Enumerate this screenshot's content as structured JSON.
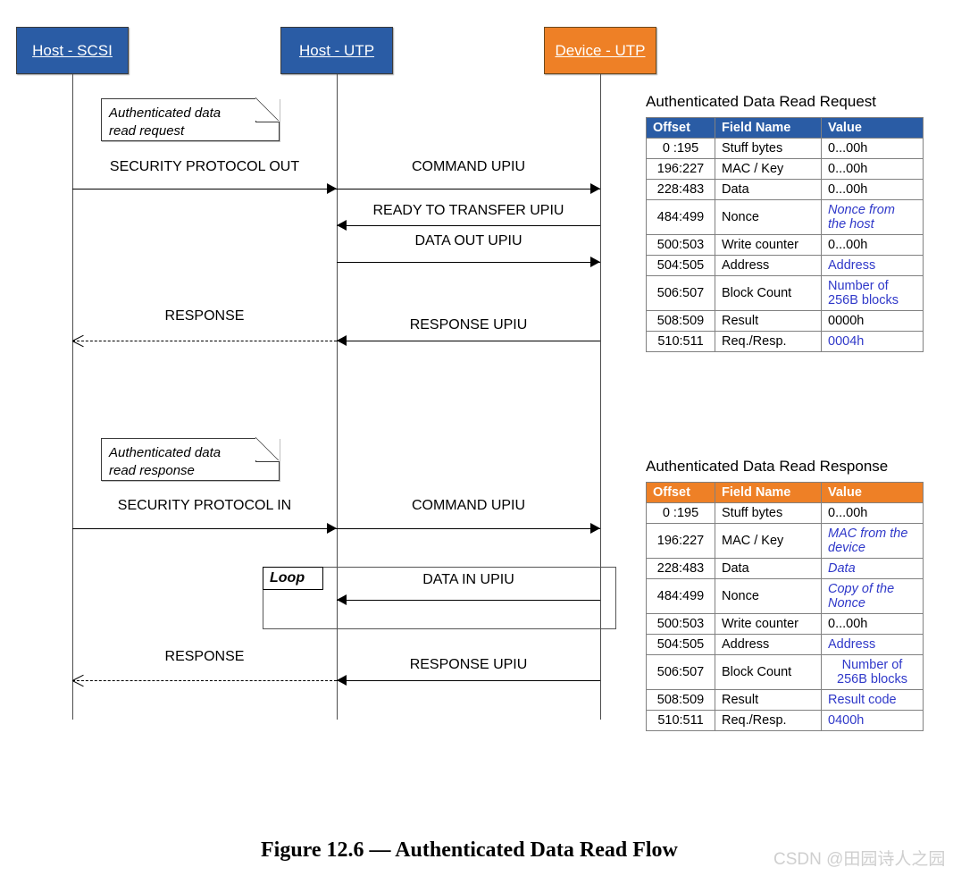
{
  "participants": [
    {
      "label": "Host - SCSI",
      "color": "#2a5ca5"
    },
    {
      "label": "Host - UTP",
      "color": "#2a5ca5"
    },
    {
      "label": "Device - UTP",
      "color": "#ee8026"
    }
  ],
  "notes": [
    {
      "line1": "Authenticated data",
      "line2": "read request"
    },
    {
      "line1": "Authenticated data",
      "line2": "read response"
    }
  ],
  "messages": [
    {
      "label": "SECURITY PROTOCOL OUT"
    },
    {
      "label": "COMMAND UPIU"
    },
    {
      "label": "READY TO TRANSFER UPIU"
    },
    {
      "label": "DATA OUT UPIU"
    },
    {
      "label": "RESPONSE"
    },
    {
      "label": "RESPONSE UPIU"
    },
    {
      "label": "SECURITY PROTOCOL IN"
    },
    {
      "label": "COMMAND UPIU"
    },
    {
      "label": "DATA IN UPIU"
    },
    {
      "label": "RESPONSE"
    },
    {
      "label": "RESPONSE UPIU"
    }
  ],
  "loop": {
    "label": "Loop"
  },
  "tables": [
    {
      "title": "Authenticated Data Read Request",
      "accent": "#2a5ca5",
      "headers": [
        "Offset",
        "Field Name",
        "Value"
      ],
      "rows": [
        {
          "offset": "0 :195",
          "field": "Stuff bytes",
          "value": "0...00h",
          "style": "plain"
        },
        {
          "offset": "196:227",
          "field": "MAC / Key",
          "value": "0...00h",
          "style": "plain"
        },
        {
          "offset": "228:483",
          "field": "Data",
          "value": "0...00h",
          "style": "plain"
        },
        {
          "offset": "484:499",
          "field": "Nonce",
          "value": "Nonce from the host",
          "style": "blue-italic"
        },
        {
          "offset": "500:503",
          "field": "Write counter",
          "value": "0...00h",
          "style": "plain"
        },
        {
          "offset": "504:505",
          "field": "Address",
          "value": "Address",
          "style": "blue"
        },
        {
          "offset": "506:507",
          "field": "Block Count",
          "value": "Number of 256B blocks",
          "style": "blue"
        },
        {
          "offset": "508:509",
          "field": "Result",
          "value": "0000h",
          "style": "plain"
        },
        {
          "offset": "510:511",
          "field": "Req./Resp.",
          "value": "0004h",
          "style": "blue"
        }
      ]
    },
    {
      "title": "Authenticated Data Read Response",
      "accent": "#ee8026",
      "headers": [
        "Offset",
        "Field Name",
        "Value"
      ],
      "rows": [
        {
          "offset": "0 :195",
          "field": "Stuff bytes",
          "value": "0...00h",
          "style": "plain"
        },
        {
          "offset": "196:227",
          "field": "MAC / Key",
          "value": "MAC from the device",
          "style": "blue-italic"
        },
        {
          "offset": "228:483",
          "field": "Data",
          "value": "Data",
          "style": "blue-italic"
        },
        {
          "offset": "484:499",
          "field": "Nonce",
          "value": "Copy of the Nonce",
          "style": "blue-italic"
        },
        {
          "offset": "500:503",
          "field": "Write counter",
          "value": "0...00h",
          "style": "plain"
        },
        {
          "offset": "504:505",
          "field": "Address",
          "value": "Address",
          "style": "blue"
        },
        {
          "offset": "506:507",
          "field": "Block Count",
          "value": "Number of 256B blocks",
          "style": "blue"
        },
        {
          "offset": "508:509",
          "field": "Result",
          "value": "Result code",
          "style": "blue"
        },
        {
          "offset": "510:511",
          "field": "Req./Resp.",
          "value": "0400h",
          "style": "blue"
        }
      ]
    }
  ],
  "caption": "Figure 12.6 — Authenticated Data Read Flow",
  "watermark": "CSDN @田园诗人之园"
}
